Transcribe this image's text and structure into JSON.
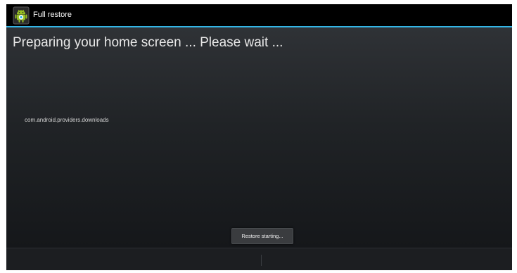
{
  "window": {
    "title": "Full restore",
    "icon": "android-robot-icon"
  },
  "main": {
    "heading": "Preparing your home screen ... Please wait ...",
    "current_package": "com.android.providers.downloads"
  },
  "toast": {
    "message": "Restore starting..."
  },
  "colors": {
    "accent": "#33b5e5",
    "titlebar_bg": "#000000",
    "content_bg_top": "#2f3236",
    "content_bg_bottom": "#15171a",
    "icon_green": "#97c024"
  }
}
